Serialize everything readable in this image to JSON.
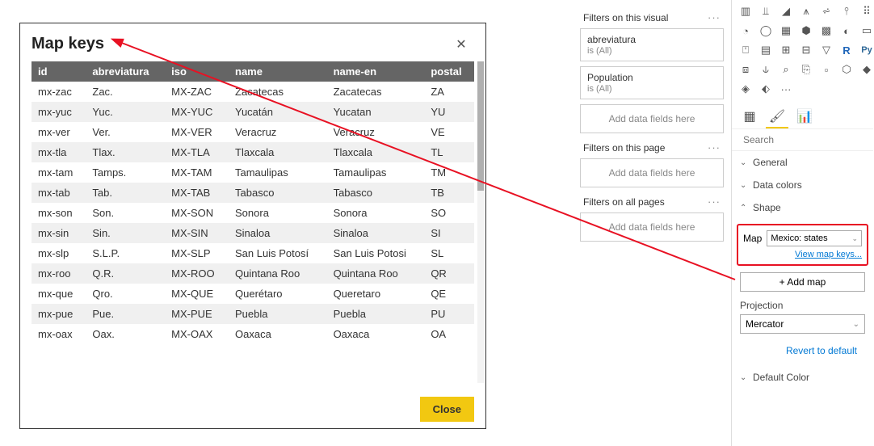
{
  "dialog": {
    "title": "Map keys",
    "close_btn": "Close",
    "columns": [
      "id",
      "abreviatura",
      "iso",
      "name",
      "name-en",
      "postal"
    ],
    "rows": [
      {
        "id": "mx-zac",
        "abrev": "Zac.",
        "iso": "MX-ZAC",
        "name": "Zacatecas",
        "name_en": "Zacatecas",
        "postal": "ZA"
      },
      {
        "id": "mx-yuc",
        "abrev": "Yuc.",
        "iso": "MX-YUC",
        "name": "Yucatán",
        "name_en": "Yucatan",
        "postal": "YU"
      },
      {
        "id": "mx-ver",
        "abrev": "Ver.",
        "iso": "MX-VER",
        "name": "Veracruz",
        "name_en": "Veracruz",
        "postal": "VE"
      },
      {
        "id": "mx-tla",
        "abrev": "Tlax.",
        "iso": "MX-TLA",
        "name": "Tlaxcala",
        "name_en": "Tlaxcala",
        "postal": "TL"
      },
      {
        "id": "mx-tam",
        "abrev": "Tamps.",
        "iso": "MX-TAM",
        "name": "Tamaulipas",
        "name_en": "Tamaulipas",
        "postal": "TM"
      },
      {
        "id": "mx-tab",
        "abrev": "Tab.",
        "iso": "MX-TAB",
        "name": "Tabasco",
        "name_en": "Tabasco",
        "postal": "TB"
      },
      {
        "id": "mx-son",
        "abrev": "Son.",
        "iso": "MX-SON",
        "name": "Sonora",
        "name_en": "Sonora",
        "postal": "SO"
      },
      {
        "id": "mx-sin",
        "abrev": "Sin.",
        "iso": "MX-SIN",
        "name": "Sinaloa",
        "name_en": "Sinaloa",
        "postal": "SI"
      },
      {
        "id": "mx-slp",
        "abrev": "S.L.P.",
        "iso": "MX-SLP",
        "name": "San Luis Potosí",
        "name_en": "San Luis Potosi",
        "postal": "SL"
      },
      {
        "id": "mx-roo",
        "abrev": "Q.R.",
        "iso": "MX-ROO",
        "name": "Quintana Roo",
        "name_en": "Quintana Roo",
        "postal": "QR"
      },
      {
        "id": "mx-que",
        "abrev": "Qro.",
        "iso": "MX-QUE",
        "name": "Querétaro",
        "name_en": "Queretaro",
        "postal": "QE"
      },
      {
        "id": "mx-pue",
        "abrev": "Pue.",
        "iso": "MX-PUE",
        "name": "Puebla",
        "name_en": "Puebla",
        "postal": "PU"
      },
      {
        "id": "mx-oax",
        "abrev": "Oax.",
        "iso": "MX-OAX",
        "name": "Oaxaca",
        "name_en": "Oaxaca",
        "postal": "OA"
      }
    ]
  },
  "filters": {
    "visual_title": "Filters on this visual",
    "visual_items": [
      {
        "title": "abreviatura",
        "value": "is (All)"
      },
      {
        "title": "Population",
        "value": "is (All)"
      }
    ],
    "page_title": "Filters on this page",
    "allpages_title": "Filters on all pages",
    "drop_label": "Add data fields here"
  },
  "viz": {
    "search_placeholder": "Search",
    "sections": {
      "general": "General",
      "data_colors": "Data colors",
      "shape": "Shape",
      "default_color": "Default Color"
    },
    "shape": {
      "map_label": "Map",
      "map_value": "Mexico: states",
      "view_keys": "View map keys...",
      "add_map": "+ Add map",
      "projection_label": "Projection",
      "projection_value": "Mercator",
      "revert": "Revert to default"
    },
    "icons_alt": {
      "more": "···"
    }
  }
}
